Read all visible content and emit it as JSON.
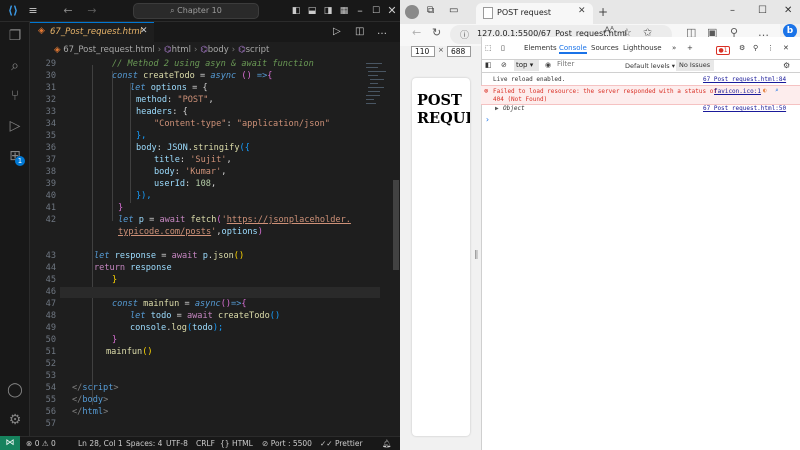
{
  "vscode": {
    "search": "Chapter 10",
    "tab": "67_Post_request.html",
    "breadcrumb": {
      "file": "67_Post_request.html",
      "items": [
        "html",
        "body",
        "script"
      ]
    },
    "lines": [
      {
        "n": "29"
      },
      {
        "n": "30"
      },
      {
        "n": "31"
      },
      {
        "n": "32"
      },
      {
        "n": "33"
      },
      {
        "n": "34"
      },
      {
        "n": "35"
      },
      {
        "n": "36"
      },
      {
        "n": "37"
      },
      {
        "n": "38"
      },
      {
        "n": "39"
      },
      {
        "n": "40"
      },
      {
        "n": "41"
      },
      {
        "n": "42"
      },
      {
        "n": ""
      },
      {
        "n": "43"
      },
      {
        "n": "44"
      },
      {
        "n": "45"
      },
      {
        "n": "46"
      },
      {
        "n": "47"
      },
      {
        "n": "48"
      },
      {
        "n": "49"
      },
      {
        "n": "50"
      },
      {
        "n": "51"
      },
      {
        "n": "52"
      },
      {
        "n": "53"
      },
      {
        "n": "54"
      },
      {
        "n": "55"
      },
      {
        "n": "56"
      },
      {
        "n": "57"
      }
    ],
    "code": {
      "l29": "// Method 2 using asyn & await function",
      "l30a": "const",
      "l30b": "createTodo",
      "l30c": " = ",
      "l30d": "async",
      "l30e": " () ",
      "l30f": "=>",
      "l30g": "{",
      "l31a": "let",
      "l31b": "options",
      "l31c": " = {",
      "l32a": "method",
      "l32b": ": ",
      "l32c": "\"POST\"",
      "l32d": ",",
      "l33a": "headers",
      "l33b": ": {",
      "l34a": "\"Content-type\"",
      "l34b": ": ",
      "l34c": "\"application/json\"",
      "l35": "},",
      "l36a": "body",
      "l36b": ": ",
      "l36c": "JSON",
      "l36d": ".",
      "l36e": "stringify",
      "l36f": "({",
      "l37a": "title",
      "l37b": ": ",
      "l37c": "'Sujit'",
      "l37d": ",",
      "l38a": "body",
      "l38b": ": ",
      "l38c": "'Kumar'",
      "l38d": ",",
      "l39a": "userId",
      "l39b": ": ",
      "l39c": "108",
      "l39d": ",",
      "l40": "}),",
      "l41": "}",
      "l42a": "let",
      "l42b": "p",
      "l42c": " = ",
      "l42d": "await",
      "l42e": " ",
      "l42f": "fetch",
      "l42g": "(",
      "l42h": "'",
      "l42i": "https://jsonplaceholder.",
      "l42j": "typicode.com/posts",
      "l42k": "'",
      "l42l": ",",
      "l42m": "options",
      "l42n": ")",
      "l43a": "let",
      "l43b": "response",
      "l43c": " = ",
      "l43d": "await",
      "l43e": " ",
      "l43f": "p",
      "l43g": ".",
      "l43h": "json",
      "l43i": "()",
      "l44a": "return",
      "l44b": " ",
      "l44c": "response",
      "l45": "}",
      "l47a": "const",
      "l47b": "mainfun",
      "l47c": " = ",
      "l47d": "async",
      "l47e": "()",
      "l47f": "=>",
      "l47g": "{",
      "l48a": "let",
      "l48b": "todo",
      "l48c": " = ",
      "l48d": "await",
      "l48e": " ",
      "l48f": "createTodo",
      "l48g": "()",
      "l49a": "console",
      "l49b": ".",
      "l49c": "log",
      "l49d": "(",
      "l49e": "todo",
      "l49f": ");",
      "l50": "}",
      "l51a": "mainfun",
      "l51b": "()",
      "l55a": "</",
      "l55b": "script",
      "l55c": ">",
      "l56a": "</",
      "l56b": "body",
      "l56c": ">",
      "l57a": "</",
      "l57b": "html",
      "l57c": ">"
    },
    "status": {
      "errors": "0",
      "warnings": "0",
      "position": "Ln 28, Col 1",
      "spaces": "Spaces: 4",
      "encoding": "UTF-8",
      "eol": "CRLF",
      "language": "HTML",
      "port": "Port : 5500",
      "prettier": "Prettier"
    }
  },
  "browser": {
    "tab_title": "POST request",
    "url": "127.0.0.1:5500/67_Post_request.html",
    "viewport_width": "110",
    "viewport_height": "688",
    "page_heading": "POST REQUEST",
    "page_heading_line1": "POST",
    "page_heading_line2": "REQUES",
    "devtools": {
      "tabs": [
        "Elements",
        "Console",
        "Sources",
        "Lighthouse"
      ],
      "error_count": "1",
      "context": "top",
      "filter_placeholder": "Filter",
      "levels": "Default levels",
      "issues": "No Issues",
      "messages": [
        {
          "text": "Live reload enabled.",
          "source": "67_Post_request.html:84",
          "type": "info"
        },
        {
          "text": "Failed to load resource: the server responded with a status of",
          "text2": "404 (Not Found)",
          "source": "favicon.ico:1",
          "type": "error"
        },
        {
          "text": "Object",
          "source": "67_Post_request.html:50",
          "type": "log"
        }
      ]
    }
  }
}
